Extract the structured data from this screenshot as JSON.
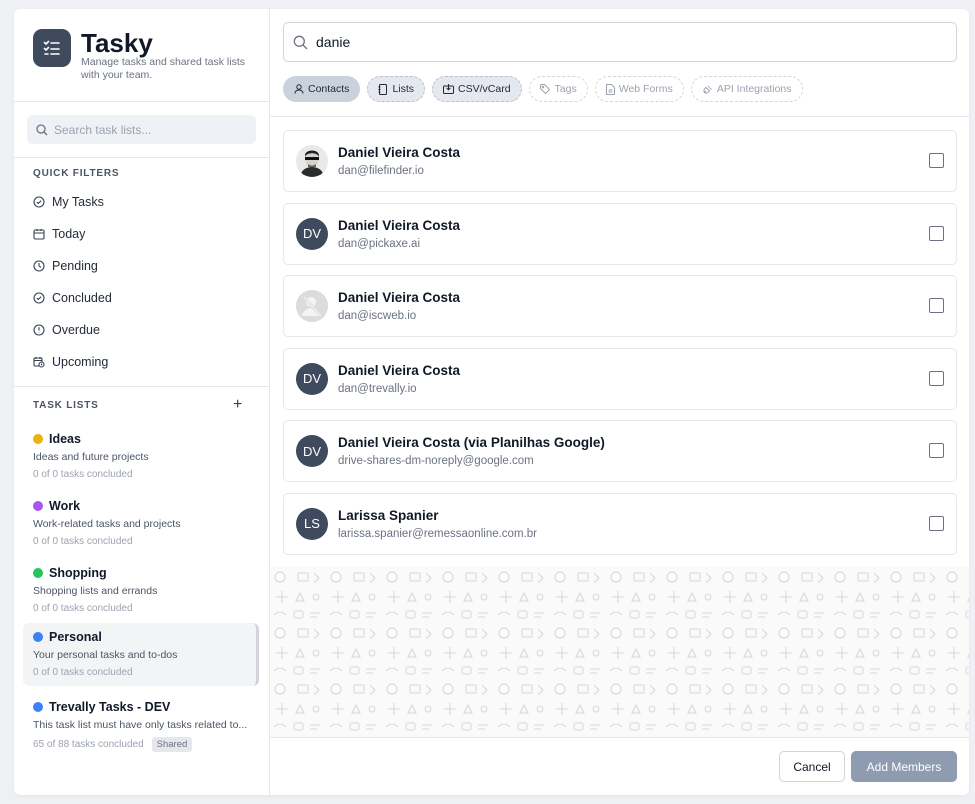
{
  "brand": {
    "title": "Tasky",
    "subtitle": "Manage tasks and shared task lists with your team.",
    "icon": "checklist-icon"
  },
  "sidebar": {
    "search_placeholder": "Search task lists...",
    "quick_filters_title": "QUICK FILTERS",
    "filters": [
      {
        "label": "My Tasks",
        "icon": "check-circle-icon"
      },
      {
        "label": "Today",
        "icon": "calendar-icon"
      },
      {
        "label": "Pending",
        "icon": "clock-icon"
      },
      {
        "label": "Concluded",
        "icon": "check-circle-icon"
      },
      {
        "label": "Overdue",
        "icon": "alert-circle-icon"
      },
      {
        "label": "Upcoming",
        "icon": "calendar-clock-icon"
      }
    ],
    "task_lists_title": "TASK LISTS",
    "add_label": "+",
    "lists": [
      {
        "name": "Ideas",
        "desc": "Ideas and future projects",
        "count": "0 of 0 tasks concluded",
        "color": "#eab308"
      },
      {
        "name": "Work",
        "desc": "Work-related tasks and projects",
        "count": "0 of 0 tasks concluded",
        "color": "#a855f7"
      },
      {
        "name": "Shopping",
        "desc": "Shopping lists and errands",
        "count": "0 of 0 tasks concluded",
        "color": "#22c55e"
      },
      {
        "name": "Personal",
        "desc": "Your personal tasks and to-dos",
        "count": "0 of 0 tasks concluded",
        "color": "#3b82f6"
      },
      {
        "name": "Trevally Tasks - DEV",
        "desc": "This task list must have only tasks related to...",
        "count": "65 of 88 tasks concluded",
        "color": "#3b82f6",
        "badge": "Shared"
      }
    ]
  },
  "main": {
    "search_value": "danie",
    "chips": [
      {
        "label": "Contacts",
        "icon": "user-icon"
      },
      {
        "label": "Lists",
        "icon": "notebook-icon"
      },
      {
        "label": "CSV/vCard",
        "icon": "import-icon"
      },
      {
        "label": "Tags",
        "icon": "tag-icon"
      },
      {
        "label": "Web Forms",
        "icon": "document-icon"
      },
      {
        "label": "API Integrations",
        "icon": "plug-icon"
      }
    ],
    "contacts": [
      {
        "name": "Daniel Vieira Costa",
        "email": "dan@filefinder.io",
        "avatar": "photo",
        "initials": ""
      },
      {
        "name": "Daniel Vieira Costa",
        "email": "dan@pickaxe.ai",
        "avatar": "initials",
        "initials": "DV"
      },
      {
        "name": "Daniel Vieira Costa",
        "email": "dan@iscweb.io",
        "avatar": "placeholder",
        "initials": ""
      },
      {
        "name": "Daniel Vieira Costa",
        "email": "dan@trevally.io",
        "avatar": "initials",
        "initials": "DV"
      },
      {
        "name": "Daniel Vieira Costa (via Planilhas Google)",
        "email": "drive-shares-dm-noreply@google.com",
        "avatar": "initials",
        "initials": "DV"
      },
      {
        "name": "Larissa Spanier",
        "email": "larissa.spanier@remessaonline.com.br",
        "avatar": "initials",
        "initials": "LS"
      }
    ],
    "cancel_label": "Cancel",
    "add_label": "Add Members"
  },
  "colors": {
    "accent": "#3f4a5f",
    "add_button": "#8f9bb0"
  }
}
